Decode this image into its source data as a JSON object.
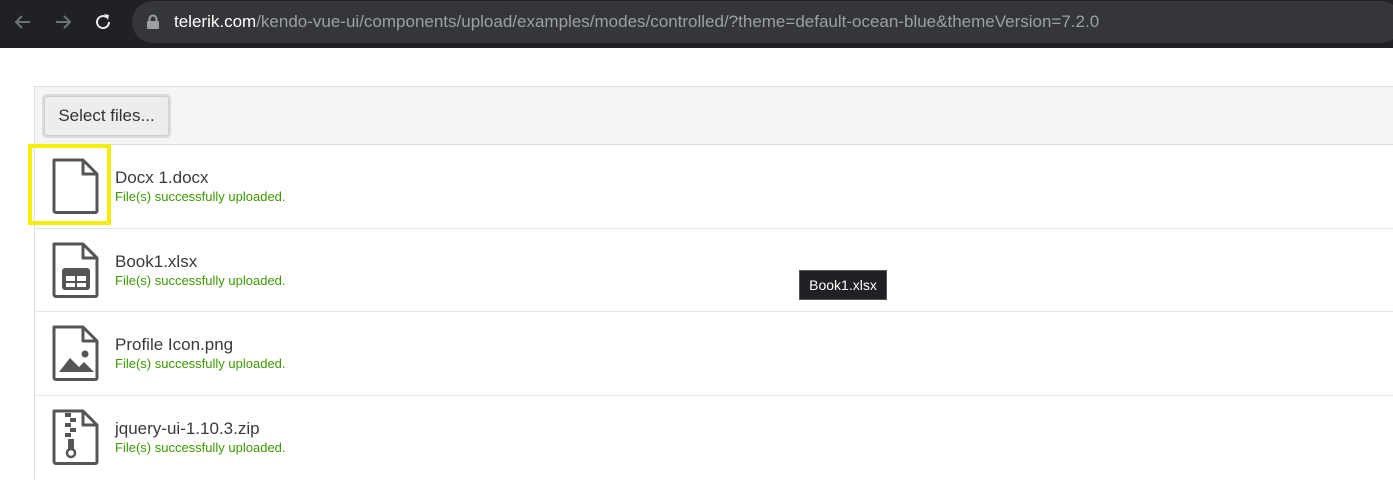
{
  "browser": {
    "url_domain": "telerik.com",
    "url_path": "/kendo-vue-ui/components/upload/examples/modes/controlled/?theme=default-ocean-blue&themeVersion=7.2.0",
    "icons": [
      "back-arrow-icon",
      "forward-arrow-icon",
      "reload-icon",
      "lock-icon"
    ]
  },
  "upload": {
    "select_label": "Select files...",
    "files": [
      {
        "name": "Docx 1.docx",
        "status": "File(s) successfully uploaded.",
        "icon": "file-icon"
      },
      {
        "name": "Book1.xlsx",
        "status": "File(s) successfully uploaded.",
        "icon": "spreadsheet-file-icon"
      },
      {
        "name": "Profile Icon.png",
        "status": "File(s) successfully uploaded.",
        "icon": "image-file-icon"
      },
      {
        "name": "jquery-ui-1.10.3.zip",
        "status": "File(s) successfully uploaded.",
        "icon": "zip-file-icon"
      }
    ]
  },
  "tooltip": {
    "text": "Book1.xlsx"
  },
  "colors": {
    "success": "#3c9a00",
    "highlight": "#f3ef0a",
    "icon": "#555555"
  }
}
